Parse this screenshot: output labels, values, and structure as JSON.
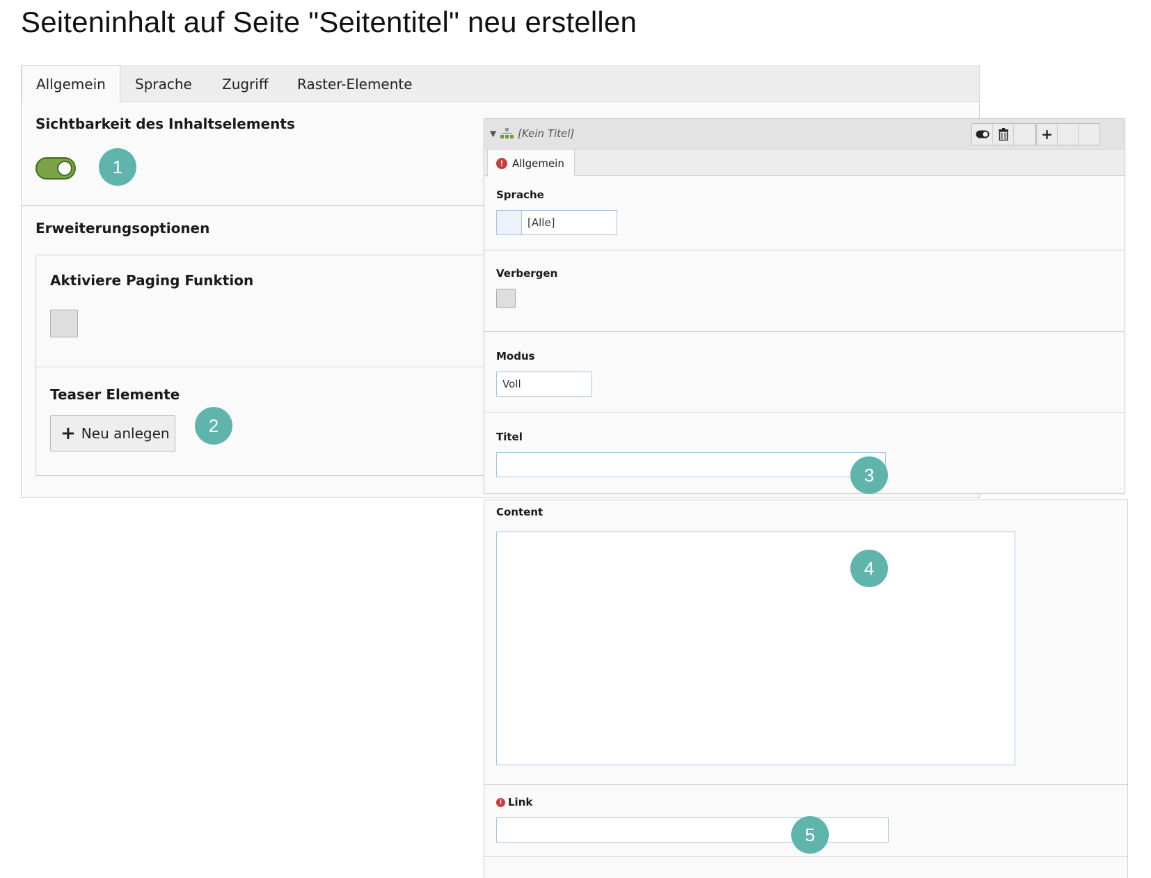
{
  "page": {
    "title": "Seiteninhalt auf Seite \"Seitentitel\" neu erstellen"
  },
  "main": {
    "tabs": [
      {
        "label": "Allgemein"
      },
      {
        "label": "Sprache"
      },
      {
        "label": "Zugriff"
      },
      {
        "label": "Raster-Elemente"
      }
    ],
    "visibility_title": "Sichtbarkeit des Inhaltselements",
    "extension_title": "Erweiterungsoptionen",
    "paging_label": "Aktiviere Paging Funktion",
    "teaser_label": "Teaser Elemente",
    "new_button_label": "Neu anlegen"
  },
  "overlay": {
    "title": "[Kein Titel]",
    "tab_label": "Allgemein",
    "sprache_label": "Sprache",
    "sprache_value": "[Alle]",
    "verbergen_label": "Verbergen",
    "modus_label": "Modus",
    "modus_value": "Voll",
    "titel_label": "Titel",
    "content_label": "Content",
    "link_label": "Link"
  },
  "badges": [
    "1",
    "2",
    "3",
    "4",
    "5"
  ],
  "colors": {
    "badge": "#5fb5ac",
    "toggle_on": "#79a548",
    "error": "#c83c3c",
    "input_border": "#a6c4e0"
  },
  "icons": {
    "toggle": "toggle-icon",
    "delete": "trash-icon",
    "add": "plus-icon",
    "error": "exclamation-icon",
    "tree": "page-tree-icon"
  }
}
